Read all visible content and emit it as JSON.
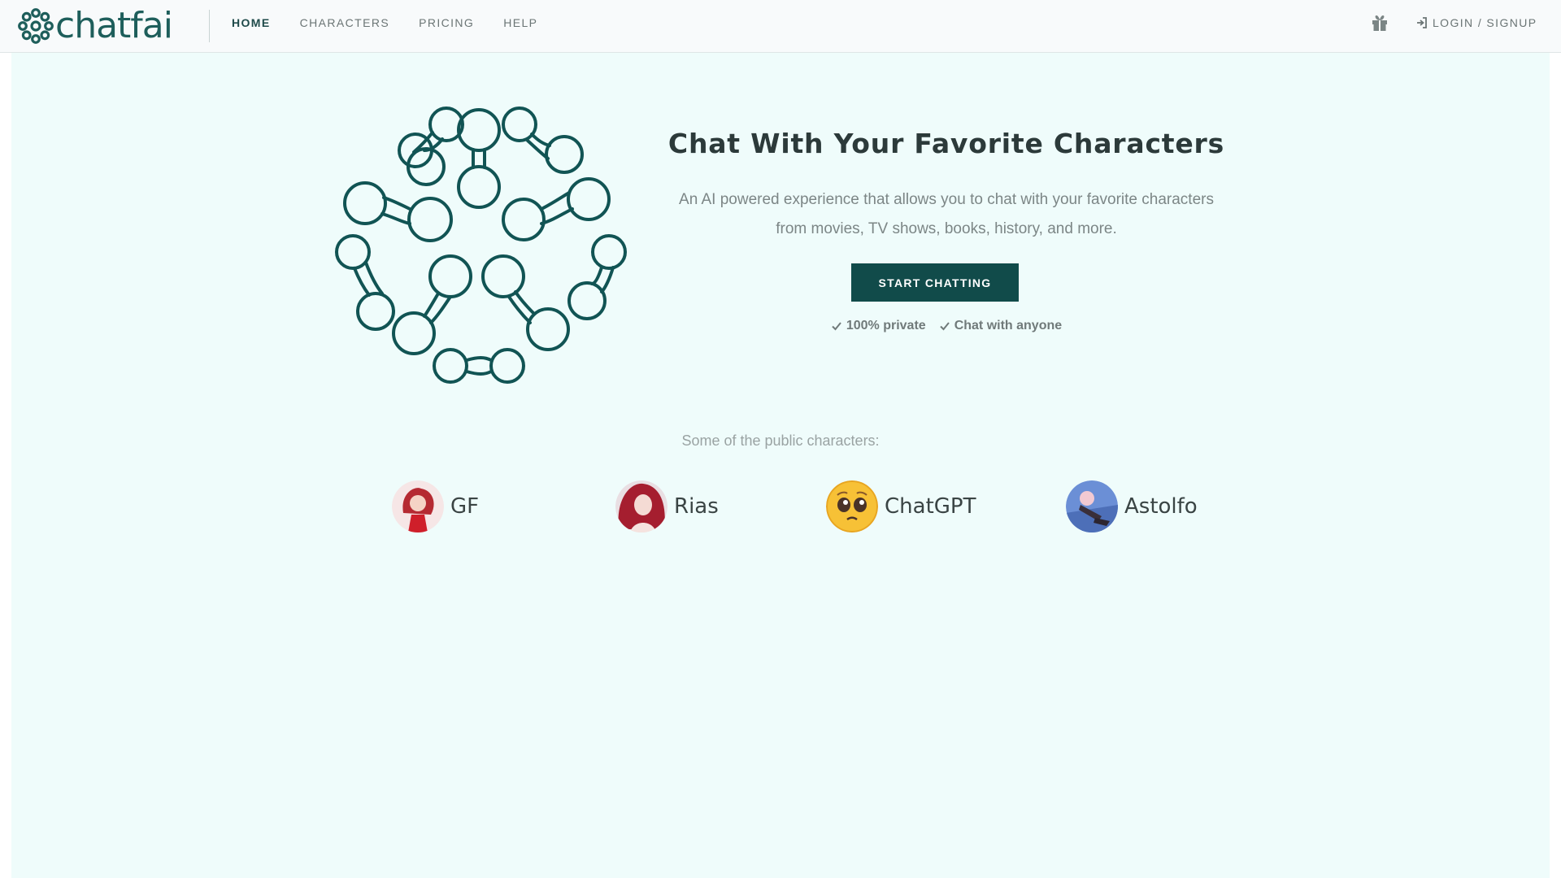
{
  "header": {
    "logo_text": "chatfai",
    "nav": [
      {
        "label": "HOME",
        "active": true
      },
      {
        "label": "CHARACTERS",
        "active": false
      },
      {
        "label": "PRICING",
        "active": false
      },
      {
        "label": "HELP",
        "active": false
      }
    ],
    "login_label": "LOGIN / SIGNUP",
    "gift_icon": "gift-icon"
  },
  "hero": {
    "title": "Chat With Your Favorite Characters",
    "subtitle_line1": "An AI powered experience that allows you to chat with your favorite characters",
    "subtitle_line2": "from movies, TV shows, books, history, and more.",
    "cta_label": "START CHATTING",
    "features": [
      "100% private",
      "Chat with anyone"
    ]
  },
  "public": {
    "label": "Some of the public characters:",
    "characters": [
      {
        "name": "GF"
      },
      {
        "name": "Rias"
      },
      {
        "name": "ChatGPT"
      },
      {
        "name": "Astolfo"
      }
    ]
  },
  "colors": {
    "brand": "#1e5e5b",
    "cta": "#114b4a",
    "background": "#effcfb"
  }
}
